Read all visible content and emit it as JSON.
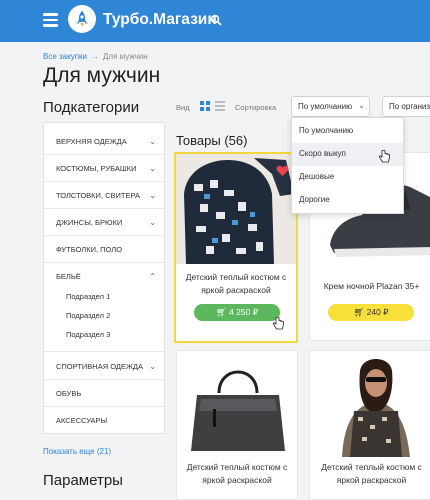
{
  "header": {
    "brand": "Турбо.Магазин"
  },
  "breadcrumb": {
    "link": "Все закупки",
    "separator": "→",
    "current": "Для мужчин"
  },
  "page": {
    "title": "Для мужчин"
  },
  "sidebar": {
    "heading": "Подкатегории",
    "items": [
      {
        "label": "Верхняя одежда",
        "chevron": "⌄"
      },
      {
        "label": "Костюмы, рубашки",
        "chevron": "⌄"
      },
      {
        "label": "Толстовки, свитера",
        "chevron": "⌄"
      },
      {
        "label": "Джинсы, брюки",
        "chevron": "⌄"
      },
      {
        "label": "Футболки, поло",
        "chevron": ""
      },
      {
        "label": "Бельё",
        "chevron": "⌃"
      },
      {
        "label": "Спортивная одежда",
        "chevron": "⌄"
      },
      {
        "label": "Обувь",
        "chevron": ""
      },
      {
        "label": "Аксессуары",
        "chevron": ""
      }
    ],
    "subitems": [
      "Подраздел 1",
      "Подраздел 2",
      "Подраздел 3"
    ],
    "more": "Показать еще (21)",
    "params_heading": "Параметры"
  },
  "toolbar": {
    "view_label": "Вид",
    "sort_label": "Сортировка",
    "sort_selected": "По умолчанию",
    "org_selected": "По организ"
  },
  "sort_options": [
    "По умолчанию",
    "Скоро выкуп",
    "Дешовые",
    "Дорогие"
  ],
  "sort_hover_index": 1,
  "products": {
    "heading": "Товары (56)",
    "cards": [
      {
        "name": "Детский теплый костюм с яркой раскраской",
        "price": "4 250 ₽"
      },
      {
        "name": "Крем ночной Plazan 35+",
        "price": "240 ₽"
      },
      {
        "name": "Детский теплый костюм с яркой раскраской",
        "price": ""
      },
      {
        "name": "Детский теплый костюм с яркой раскраской",
        "price": ""
      }
    ]
  },
  "colors": {
    "brand_blue": "#2f86d6",
    "accent_yellow": "#f7e03a",
    "buy_green": "#5cb85c"
  }
}
